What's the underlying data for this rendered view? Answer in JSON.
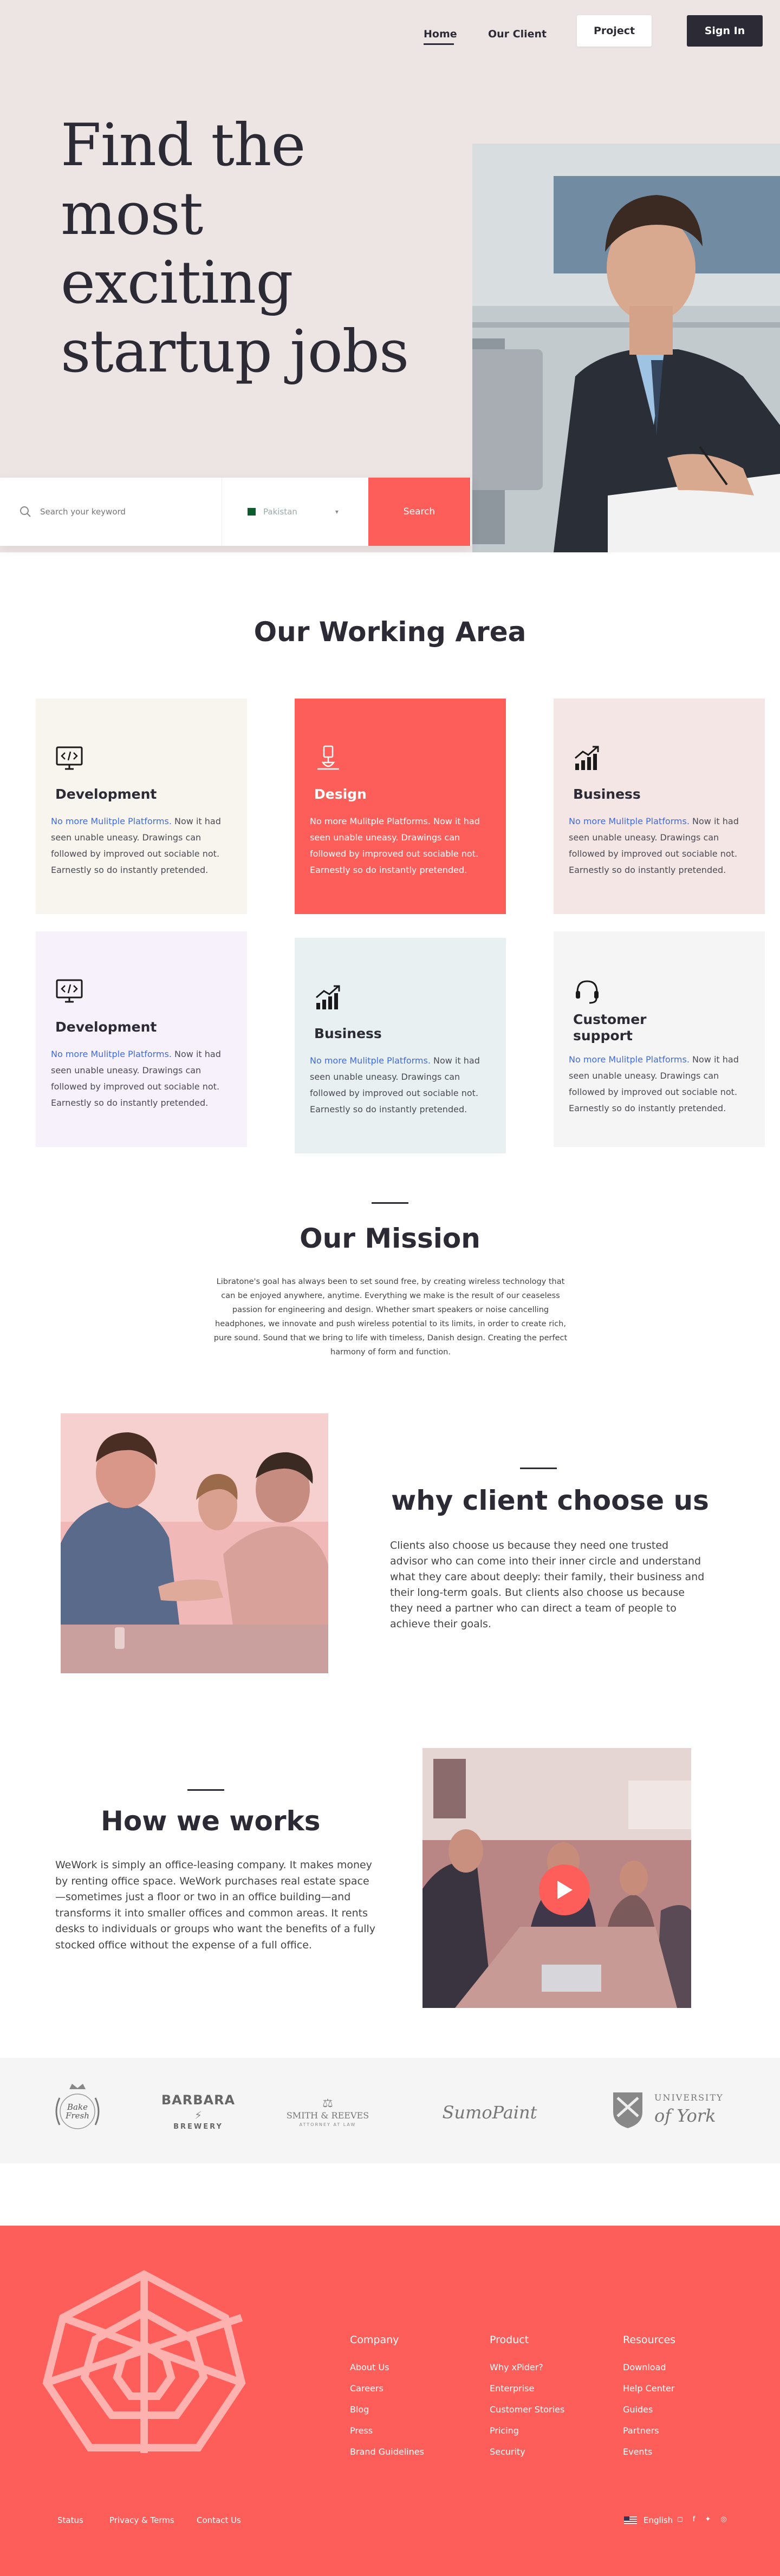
{
  "nav": {
    "home": "Home",
    "our_client": "Our Client",
    "project": "Project",
    "sign_in": "Sign In"
  },
  "hero": {
    "title_line1": "Find the",
    "title_line2": "most exciting",
    "title_line3": "startup jobs"
  },
  "search": {
    "keyword_placeholder": "Search your keyword",
    "country": "Pakistan",
    "button": "Search"
  },
  "working_area": {
    "title": "Our Working Area",
    "cards": [
      {
        "title": "Development",
        "highlight": "No more Mulitple Platforms.",
        "body": " Now it had seen unable uneasy. Drawings can followed by improved out sociable not. Earnestly so do instantly pretended."
      },
      {
        "title": "Design",
        "highlight": "No more Mulitple Platforms.",
        "body": " Now it had seen unable uneasy. Drawings can followed by improved out sociable not. Earnestly so do instantly pretended."
      },
      {
        "title": "Business",
        "highlight": "No more Mulitple Platforms.",
        "body": " Now it had seen unable uneasy. Drawings can followed by improved out sociable not. Earnestly so do instantly pretended."
      },
      {
        "title": "Development",
        "highlight": "No more Mulitple Platforms.",
        "body": " Now it had seen unable uneasy. Drawings can followed by improved out sociable not. Earnestly so do instantly pretended."
      },
      {
        "title": "Business",
        "highlight": "No more Mulitple Platforms.",
        "body": " Now it had seen unable uneasy. Drawings can followed by improved out sociable not. Earnestly so do instantly pretended."
      },
      {
        "title": "Customer support",
        "highlight": "No more Mulitple Platforms.",
        "body": " Now it had seen unable uneasy. Drawings can followed by improved out sociable not. Earnestly so do instantly pretended."
      }
    ],
    "card_colors": [
      "#f8f5ee",
      "#fe5e5a",
      "#f4e6e4",
      "#f6f1fb",
      "#e9f0f2",
      "#f5f5f5"
    ]
  },
  "mission": {
    "title": "Our Mission",
    "text": "Libratone's goal has always been to set sound free, by creating wireless technology that can be enjoyed anywhere, anytime. Everything we make is the result of our ceaseless passion for engineering and design. Whether smart speakers or noise cancelling headphones, we innovate and push wireless potential to its limits, in order to create rich, pure sound. Sound that we bring to life with timeless, Danish design. Creating the perfect harmony of form and function."
  },
  "choose": {
    "title": "why client choose us",
    "text": "Clients also choose us because they need one trusted advisor who can come into their inner circle and understand what they care about deeply: their family, their business and their long-term goals. But clients also choose us because they need a partner who can direct a team of people to achieve their goals."
  },
  "how": {
    "title": "How we works",
    "text": "WeWork is simply an office-leasing company. It makes money by renting office space. WeWork purchases real estate space—sometimes just a floor or two in an office building—and transforms it into smaller offices and common areas. It rents desks to individuals or groups who want the benefits of a fully stocked office without the expense of a full office."
  },
  "brands": {
    "b1": "Bake Fresh",
    "b2_top": "BARBARA",
    "b2_bottom": "BREWERY",
    "b3_top": "SMITH & REEVES",
    "b3_bottom": "ATTORNEY AT LAW",
    "b4": "SumoPaint",
    "b5_top": "UNIVERSITY",
    "b5_bottom": "of York"
  },
  "footer": {
    "company": {
      "heading": "Company",
      "links": [
        "About Us",
        "Careers",
        "Blog",
        "Press",
        "Brand Guidelines"
      ]
    },
    "product": {
      "heading": "Product",
      "links": [
        "Why xPider?",
        "Enterprise",
        "Customer Stories",
        "Pricing",
        "Security"
      ]
    },
    "resources": {
      "heading": "Resources",
      "links": [
        "Download",
        "Help Center",
        "Guides",
        "Partners",
        "Events"
      ]
    },
    "bottom": {
      "status": "Status",
      "privacy": "Privacy & Terms",
      "contact": "Contact Us",
      "language": "English"
    }
  },
  "colors": {
    "accent": "#fe5e5a",
    "dark": "#2b2a35",
    "hero_bg": "#ede5e3"
  }
}
